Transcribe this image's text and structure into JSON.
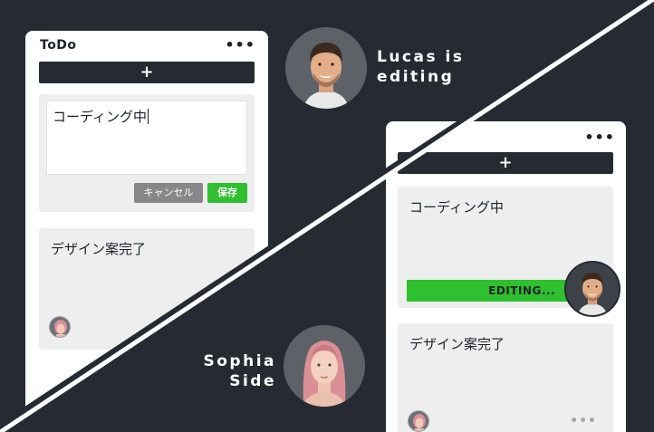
{
  "left_panel": {
    "title": "ToDo",
    "menu_glyph": "•••",
    "add_glyph": "+",
    "edit_card": {
      "value": "コーディング中",
      "cancel_label": "キャンセル",
      "save_label": "保存"
    },
    "card2": {
      "text": "デザイン案完了"
    }
  },
  "right_panel": {
    "menu_glyph": "•••",
    "add_glyph": "+",
    "card1": {
      "text": "コーディング中",
      "status": "EDITING..."
    },
    "card2": {
      "text": "デザイン案完了",
      "more_glyph": "•••"
    }
  },
  "labels": {
    "lucas_line1": "Lucas is",
    "lucas_line2": "editing",
    "sophia_line1": "Sophia",
    "sophia_line2": "Side"
  },
  "colors": {
    "background": "#262b33",
    "accent_green": "#2ec02e",
    "cancel_gray": "#878787",
    "card_gray": "#eeeeee"
  },
  "icons": [
    "more-dots-icon",
    "plus-icon",
    "avatar-lucas",
    "avatar-sophia"
  ]
}
